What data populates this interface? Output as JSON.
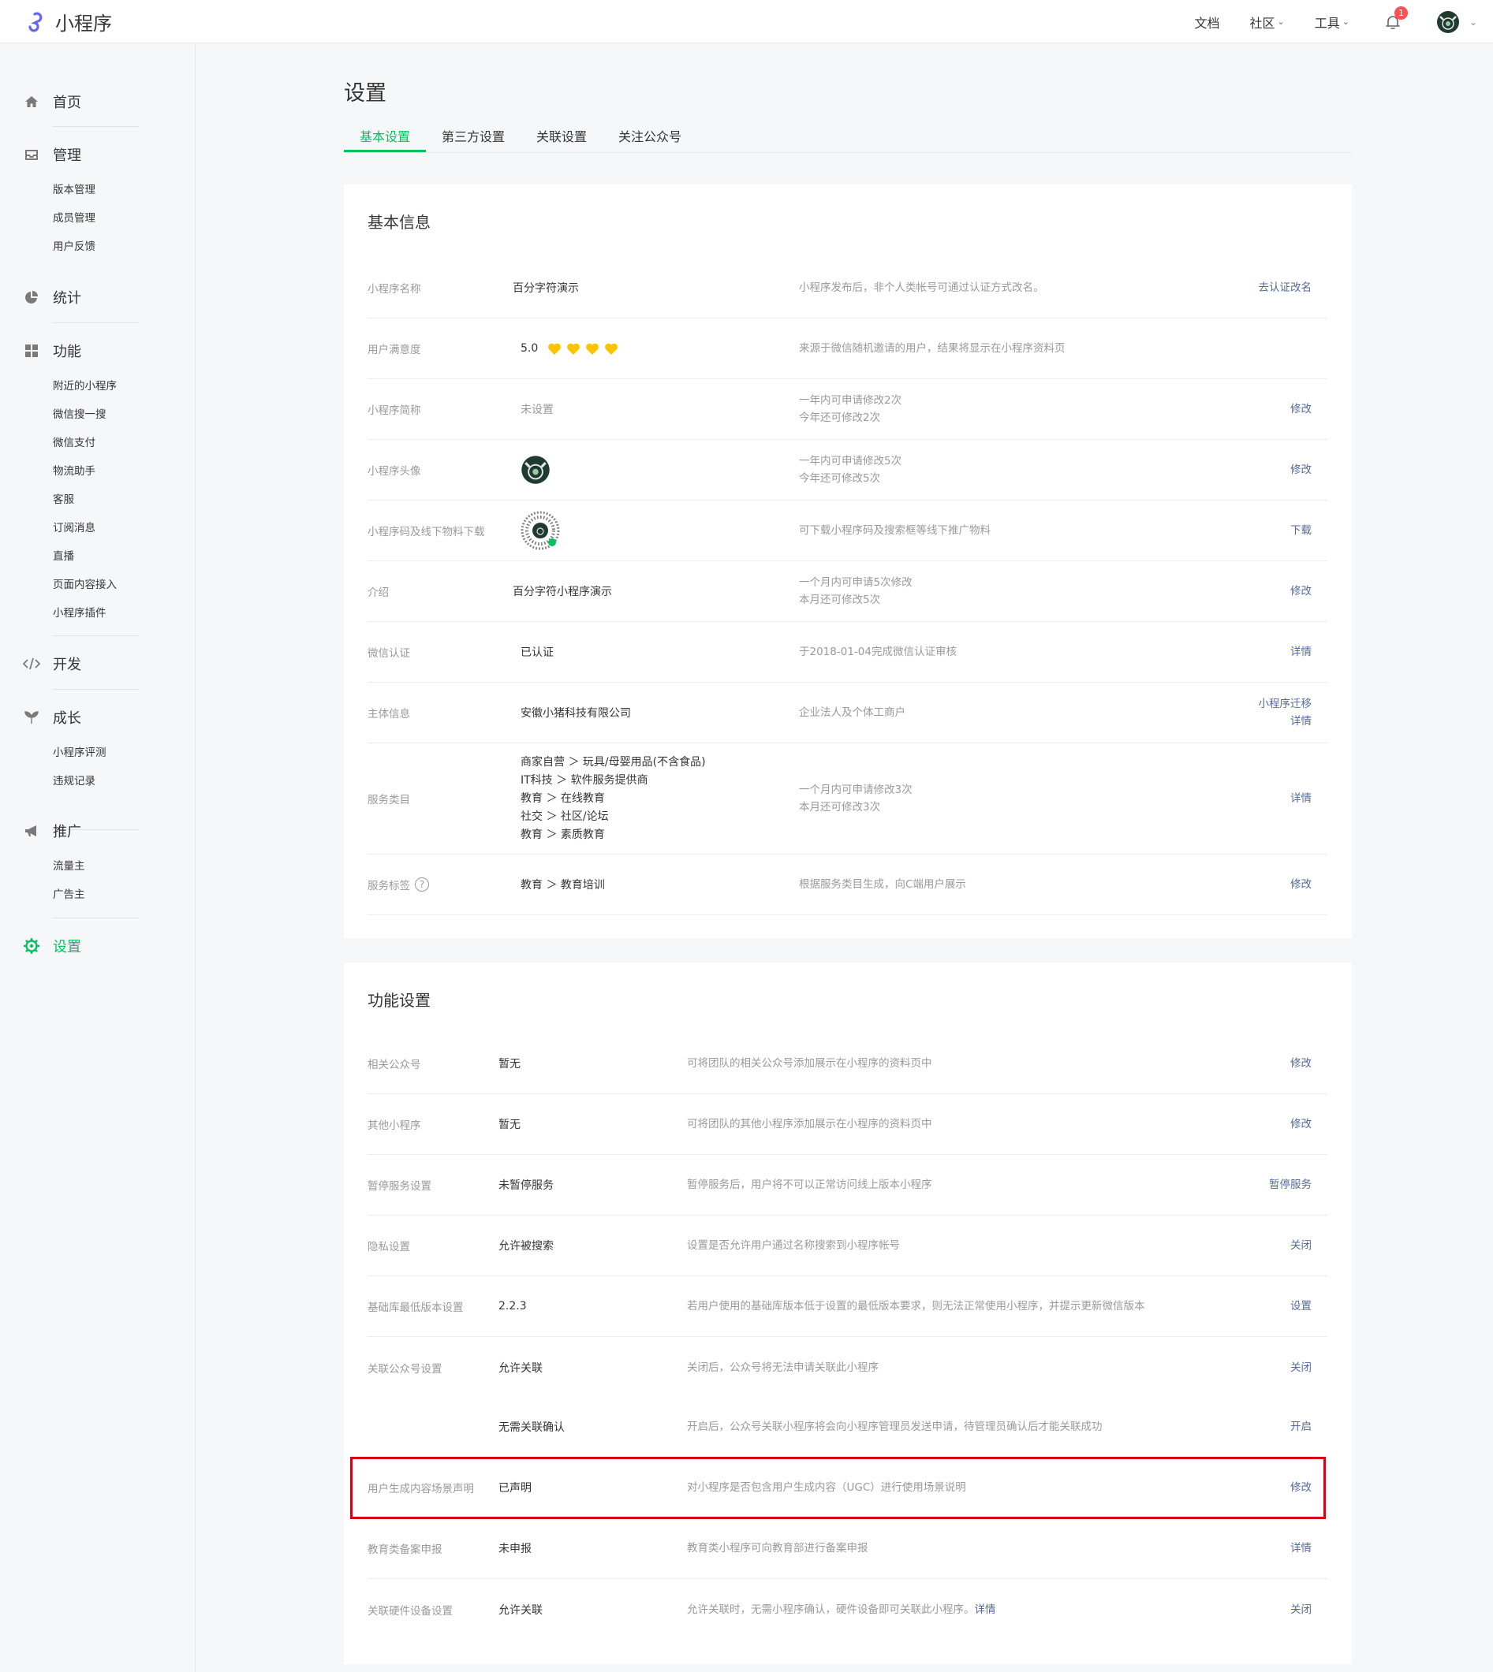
{
  "topbar": {
    "app_name": "小程序",
    "nav": [
      {
        "label": "文档"
      },
      {
        "label": "社区",
        "dropdown": true
      },
      {
        "label": "工具",
        "dropdown": true
      }
    ],
    "notification_count": "1",
    "chevron": "⌄"
  },
  "sidebar": {
    "groups": [
      {
        "title": "首页",
        "icon": "home-icon",
        "items": []
      },
      {
        "title": "管理",
        "icon": "inbox-icon",
        "items": [
          "版本管理",
          "成员管理",
          "用户反馈"
        ]
      },
      {
        "title": "统计",
        "icon": "pie-chart-icon",
        "items": []
      },
      {
        "title": "功能",
        "icon": "grid-icon",
        "items": [
          "附近的小程序",
          "微信搜一搜",
          "微信支付",
          "物流助手",
          "客服",
          "订阅消息",
          "直播",
          "页面内容接入",
          "小程序插件"
        ]
      },
      {
        "title": "开发",
        "icon": "code-icon",
        "items": []
      },
      {
        "title": "成长",
        "icon": "sprout-icon",
        "items": [
          "小程序评测",
          "违规记录"
        ]
      },
      {
        "title": "推广",
        "icon": "megaphone-icon",
        "items": [
          "流量主",
          "广告主"
        ]
      },
      {
        "title": "设置",
        "icon": "gear-icon",
        "items": [],
        "active": true
      }
    ]
  },
  "page": {
    "title": "设置",
    "tabs": [
      {
        "label": "基本设置",
        "active": true
      },
      {
        "label": "第三方设置"
      },
      {
        "label": "关联设置"
      },
      {
        "label": "关注公众号"
      }
    ]
  },
  "basic_info": {
    "title": "基本信息",
    "rows": [
      {
        "label": "小程序名称",
        "value": "百分字符演示",
        "desc": [
          "小程序发布后，非个人类帐号可通过认证方式改名。"
        ],
        "actions": [
          "去认证改名"
        ]
      },
      {
        "label": "用户满意度",
        "value": "5.0",
        "hearts": 4,
        "desc": [
          "来源于微信随机邀请的用户，结果将显示在小程序资料页"
        ],
        "actions": []
      },
      {
        "label": "小程序简称",
        "value": "未设置",
        "desc": [
          "一年内可申请修改2次",
          "今年还可修改2次"
        ],
        "actions": [
          "修改"
        ]
      },
      {
        "label": "小程序头像",
        "value": "",
        "desc": [
          "一年内可申请修改5次",
          "今年还可修改5次"
        ],
        "actions": [
          "修改"
        ]
      },
      {
        "label": "小程序码及线下物料下载",
        "value": "",
        "desc": [
          "可下载小程序码及搜索框等线下推广物料"
        ],
        "actions": [
          "下载"
        ]
      },
      {
        "label": "介绍",
        "value": "百分字符小程序演示",
        "desc": [
          "一个月内可申请5次修改",
          "本月还可修改5次"
        ],
        "actions": [
          "修改"
        ]
      },
      {
        "label": "微信认证",
        "value": "已认证",
        "desc": [
          "于2018-01-04完成微信认证审核"
        ],
        "actions": [
          "详情"
        ]
      },
      {
        "label": "主体信息",
        "value": "安徽小猪科技有限公司",
        "desc": [
          "企业法人及个体工商户"
        ],
        "actions": [
          "小程序迁移",
          "详情"
        ]
      },
      {
        "label": "服务类目",
        "values": [
          "商家自营 ＞ 玩具/母婴用品(不含食品)",
          "IT科技 ＞ 软件服务提供商",
          "教育 ＞ 在线教育",
          "社交 ＞ 社区/论坛",
          "教育 ＞ 素质教育"
        ],
        "desc": [
          "一个月内可申请修改3次",
          "本月还可修改3次"
        ],
        "actions": [
          "详情"
        ]
      },
      {
        "label": "服务标签",
        "help": "?",
        "value": "教育 ＞ 教育培训",
        "desc": [
          "根据服务类目生成，向C端用户展示"
        ],
        "actions": [
          "修改"
        ]
      }
    ]
  },
  "feature_settings": {
    "title": "功能设置",
    "rows": [
      {
        "label": "相关公众号",
        "value": "暂无",
        "desc": "可将团队的相关公众号添加展示在小程序的资料页中",
        "action": "修改"
      },
      {
        "label": "其他小程序",
        "value": "暂无",
        "desc": "可将团队的其他小程序添加展示在小程序的资料页中",
        "action": "修改"
      },
      {
        "label": "暂停服务设置",
        "value": "未暂停服务",
        "desc": "暂停服务后，用户将不可以正常访问线上版本小程序",
        "action": "暂停服务"
      },
      {
        "label": "隐私设置",
        "value": "允许被搜索",
        "desc": "设置是否允许用户通过名称搜索到小程序帐号",
        "action": "关闭"
      },
      {
        "label": "基础库最低版本设置",
        "value": "2.2.3",
        "desc": "若用户使用的基础库版本低于设置的最低版本要求，则无法正常使用小程序，并提示更新微信版本",
        "action": "设置"
      },
      {
        "label": "关联公众号设置",
        "value": "允许关联",
        "desc": "关闭后，公众号将无法申请关联此小程序",
        "action": "关闭"
      },
      {
        "label": "",
        "value": "无需关联确认",
        "desc": "开启后，公众号关联小程序将会向小程序管理员发送申请，待管理员确认后才能关联成功",
        "action": "开启"
      },
      {
        "label": "用户生成内容场景声明",
        "value": "已声明",
        "desc": "对小程序是否包含用户生成内容（UGC）进行使用场景说明",
        "action": "修改"
      },
      {
        "label": "教育类备案申报",
        "value": "未申报",
        "desc": "教育类小程序可向教育部进行备案申报",
        "action": "详情"
      },
      {
        "label": "关联硬件设备设置",
        "value": "允许关联",
        "desc": "允许关联时，无需小程序确认，硬件设备即可关联此小程序。",
        "desc_link": "详情",
        "action": "关闭"
      }
    ]
  },
  "colors": {
    "accent": "#07c160",
    "link": "#576b95",
    "highlight": "#d9001b",
    "heart": "#ffc300"
  }
}
